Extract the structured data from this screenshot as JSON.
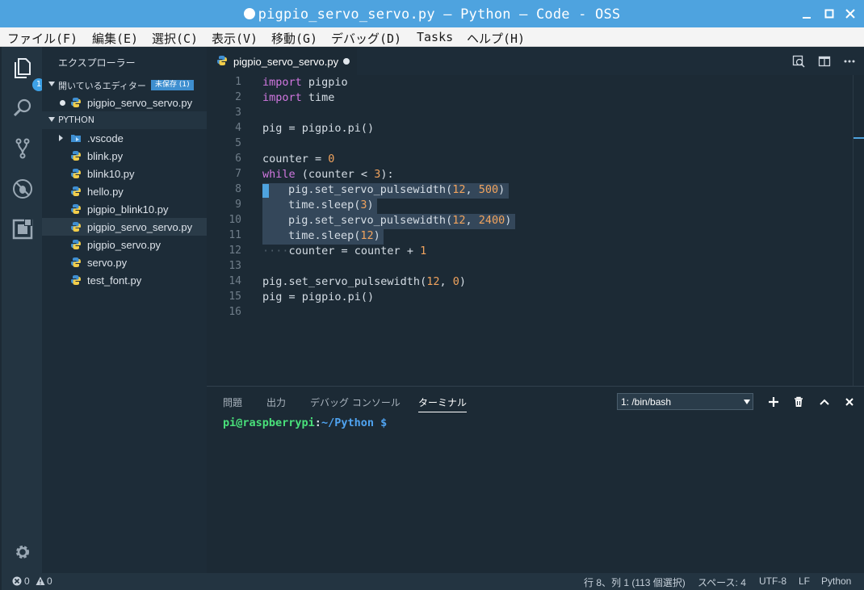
{
  "window": {
    "title": "pigpio_servo_servo.py — Python — Code - OSS"
  },
  "menu": [
    "ファイル(F)",
    "編集(E)",
    "選択(C)",
    "表示(V)",
    "移動(G)",
    "デバッグ(D)",
    "Tasks",
    "ヘルプ(H)"
  ],
  "activity": {
    "explorer_badge": "1"
  },
  "sidebar": {
    "header": "エクスプローラー",
    "open_editors": {
      "label": "開いているエディター",
      "badge": "未保存 (1)",
      "files": [
        "pigpio_servo_servo.py"
      ]
    },
    "folder": {
      "label": "PYTHON"
    },
    "files": [
      ".vscode",
      "blink.py",
      "blink10.py",
      "hello.py",
      "pigpio_blink10.py",
      "pigpio_servo_servo.py",
      "pigpio_servo.py",
      "servo.py",
      "test_font.py"
    ]
  },
  "tab": {
    "label": "pigpio_servo_servo.py"
  },
  "editor": {
    "line_numbers": [
      "1",
      "2",
      "3",
      "4",
      "5",
      "6",
      "7",
      "8",
      "9",
      "10",
      "11",
      "12",
      "13",
      "14",
      "15",
      "16"
    ],
    "lines": {
      "l1_kw": "import",
      "l1_rest": " pigpio",
      "l2_kw": "import",
      "l2_rest": " time",
      "l4": "pig = pigpio.pi()",
      "l6_a": "counter = ",
      "l6_n": "0",
      "l7_kw": "while",
      "l7_a": " (counter < ",
      "l7_n": "3",
      "l7_b": "):",
      "l8_a": "pig.set_servo_pulsewidth(",
      "l8_n1": "12",
      "l8_b": ", ",
      "l8_n2": "500",
      "l8_c": ")",
      "l9_a": "time.sleep(",
      "l9_n": "3",
      "l9_b": ")",
      "l10_a": "pig.set_servo_pulsewidth(",
      "l10_n1": "12",
      "l10_b": ", ",
      "l10_n2": "2400",
      "l10_c": ")",
      "l11_a": "time.sleep(",
      "l11_n": "12",
      "l11_b": ")",
      "l12_ws": "····",
      "l12_a": "counter = counter + ",
      "l12_n": "1",
      "l14_a": "pig.set_servo_pulsewidth(",
      "l14_n1": "12",
      "l14_b": ", ",
      "l14_n2": "0",
      "l14_c": ")",
      "l15": "pig = pigpio.pi()"
    }
  },
  "panel": {
    "tabs": [
      "問題",
      "出力",
      "デバッグ コンソール",
      "ターミナル"
    ],
    "terminal_select": "1: /bin/bash",
    "prompt": {
      "user": "pi@raspberrypi",
      "colon": ":",
      "path": "~/Python $"
    }
  },
  "status": {
    "errors": "0",
    "warnings": "0",
    "position": "行 8、列 1 (113 個選択)",
    "spaces": "スペース: 4",
    "encoding": "UTF-8",
    "eol": "LF",
    "language": "Python"
  },
  "colors": {
    "accent": "#4ea3df",
    "keyword": "#d177e0",
    "number": "#f0a35e",
    "prompt_user": "#49e07a",
    "prompt_path": "#4fa3f0"
  }
}
